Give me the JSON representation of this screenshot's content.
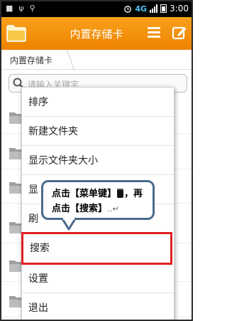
{
  "status_bar": {
    "left_glyphs": [
      "■",
      "ψ",
      "⚲"
    ],
    "network": "4G",
    "time": "3:00"
  },
  "title_bar": {
    "title": "内置存储卡"
  },
  "breadcrumb": {
    "path": "内置存储卡"
  },
  "search": {
    "placeholder": "请输入关键字"
  },
  "menu": {
    "items": [
      {
        "label": "排序"
      },
      {
        "label": "新建文件夹"
      },
      {
        "label": "显示文件夹大小"
      },
      {
        "label": "显"
      },
      {
        "label": "刷"
      },
      {
        "label": "搜索"
      },
      {
        "label": "设置"
      },
      {
        "label": "退出"
      }
    ],
    "highlighted_index": 5,
    "highlight_color": "#e02020"
  },
  "callout": {
    "line1_prefix": "点击【菜单键】",
    "line1_suffix": "，再",
    "line2": "点击【搜索】",
    "line2_suffix": "‥↵"
  },
  "colors": {
    "accent": "#f39214",
    "callout_border": "#4a6b8c"
  }
}
